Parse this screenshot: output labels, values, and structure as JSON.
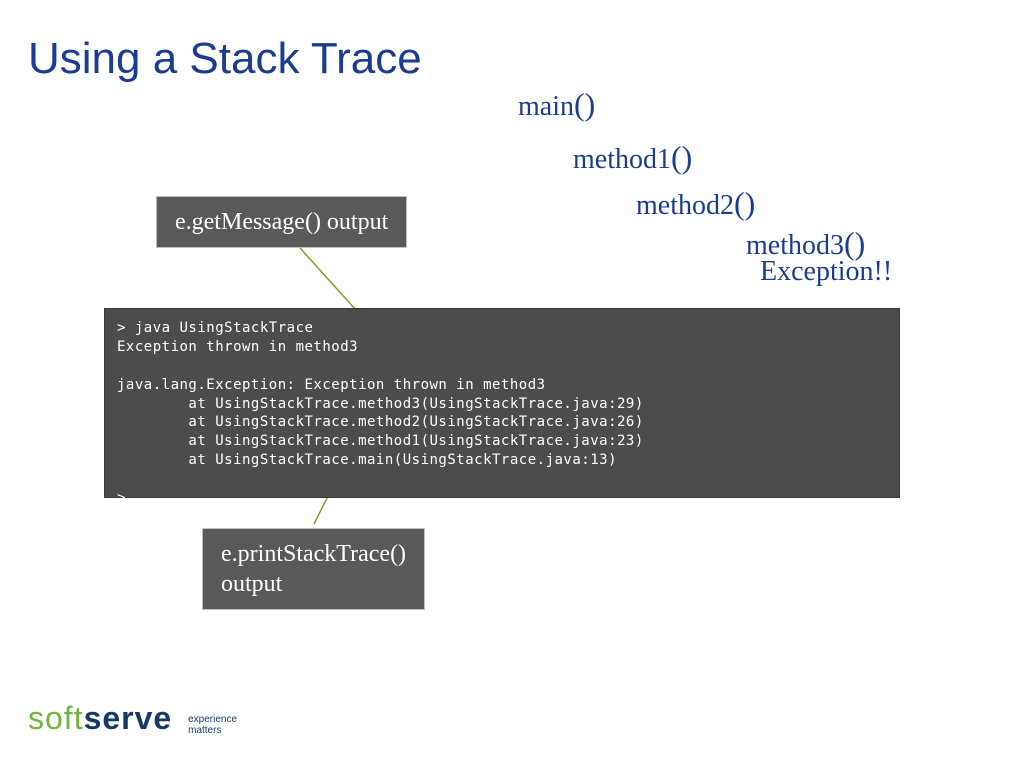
{
  "title": "Using a Stack Trace",
  "callstack": {
    "items": [
      {
        "name": "main",
        "parens": "()"
      },
      {
        "name": "method1",
        "parens": "()"
      },
      {
        "name": "method2",
        "parens": "()"
      },
      {
        "name": "method3",
        "parens": "()"
      }
    ],
    "exception": "Exception!!"
  },
  "labels": {
    "getmessage": "e.getMessage() output",
    "printstack_line1": "e.printStackTrace()",
    "printstack_line2": "output"
  },
  "console": {
    "line1": "> java UsingStackTrace",
    "line2": "Exception thrown in method3",
    "line3": "",
    "line4": "java.lang.Exception: Exception thrown in method3",
    "line5": "        at UsingStackTrace.method3(UsingStackTrace.java:29)",
    "line6": "        at UsingStackTrace.method2(UsingStackTrace.java:26)",
    "line7": "        at UsingStackTrace.method1(UsingStackTrace.java:23)",
    "line8": "        at UsingStackTrace.main(UsingStackTrace.java:13)",
    "line9": "",
    "line10": ">"
  },
  "logo": {
    "part1": "soft",
    "part2": "serve",
    "tag1": "experience",
    "tag2": "matters"
  }
}
